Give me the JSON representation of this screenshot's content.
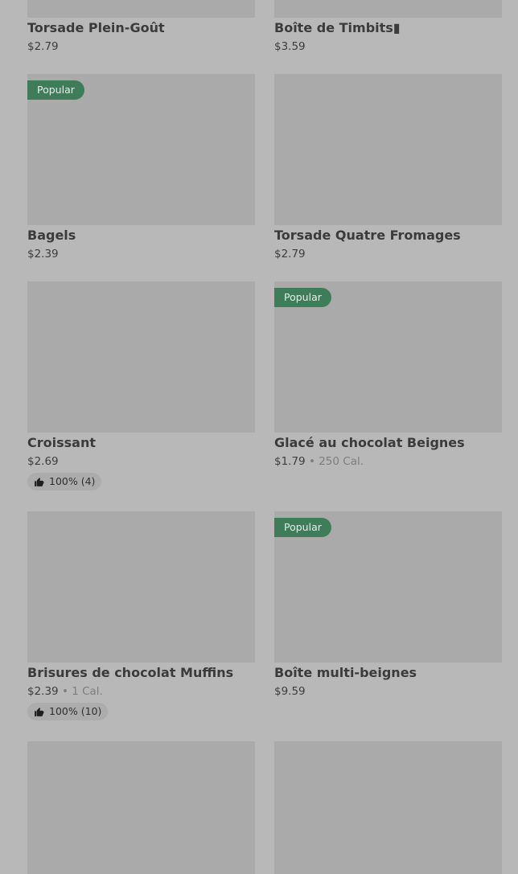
{
  "items": [
    {
      "name": "Torsade Plein-Goût",
      "price": "$2.79"
    },
    {
      "name": "Boîte de Timbits▮",
      "price": "$3.59"
    },
    {
      "badge": "Popular",
      "name": "Bagels",
      "price": "$2.39"
    },
    {
      "name": "Torsade Quatre Fromages",
      "price": "$2.79"
    },
    {
      "name": "Croissant",
      "price": "$2.69",
      "rating": "100% (4)"
    },
    {
      "badge": "Popular",
      "name": "Glacé au chocolat Beignes",
      "price": "$1.79",
      "separator": "•",
      "calories": "250 Cal."
    },
    {
      "name": "Brisures de chocolat Muffins",
      "price": "$2.39",
      "separator": "•",
      "calories": "1 Cal.",
      "rating": "100% (10)"
    },
    {
      "badge": "Popular",
      "name": "Boîte multi-beignes",
      "price": "$9.59"
    }
  ],
  "icons": {
    "rating": "thumbs-up-icon"
  },
  "colors": {
    "badge": "#3f7d5a",
    "overlay_background": "#b8b8b8",
    "image_placeholder": "#aaaaaa"
  }
}
